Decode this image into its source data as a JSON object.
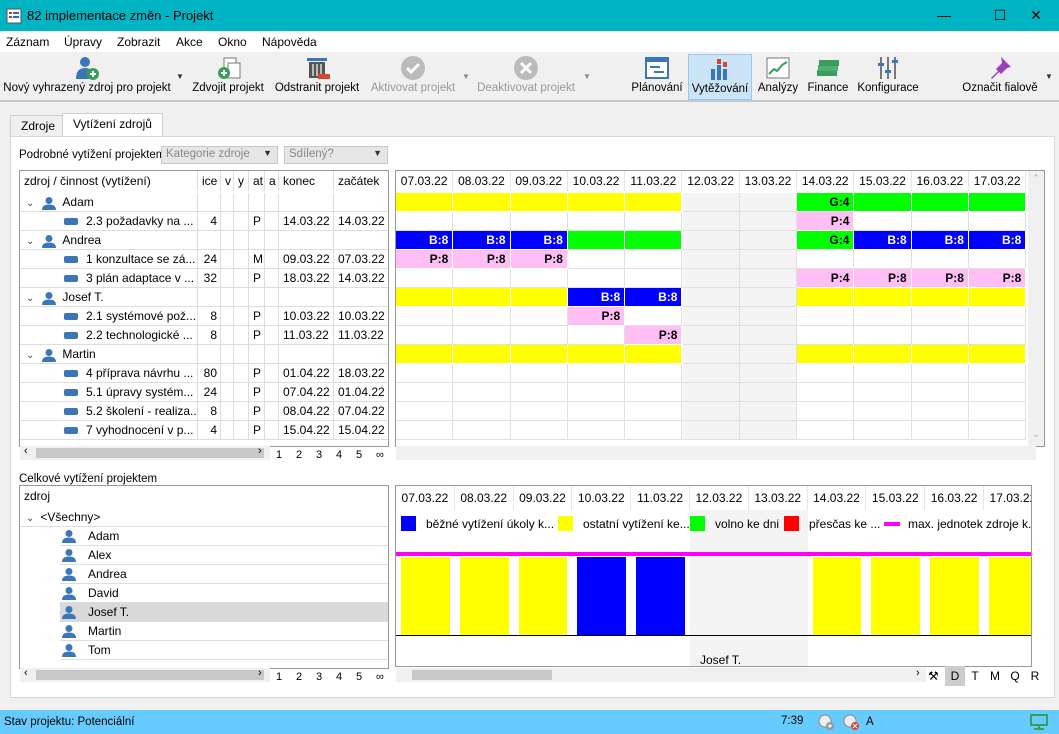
{
  "window": {
    "title": "82 implementace změn  - Projekt",
    "minimize": "—",
    "maximize": "☐",
    "close": "✕"
  },
  "menu": [
    "Záznam",
    "Úpravy",
    "Zobrazit",
    "Akce",
    "Okno",
    "Nápověda"
  ],
  "toolbar": [
    {
      "label": "Nový vyhrazený zdroj pro projekt",
      "icon": "add-user-icon",
      "enabled": true
    },
    {
      "label": "Zdvojit projekt",
      "icon": "duplicate-icon",
      "enabled": true
    },
    {
      "label": "Odstranit projekt",
      "icon": "trash-icon",
      "enabled": true
    },
    {
      "label": "Aktivovat projekt",
      "icon": "check-circle-icon",
      "enabled": false
    },
    {
      "label": "Deaktivovat projekt",
      "icon": "x-circle-icon",
      "enabled": false
    },
    {
      "label": "Plánování",
      "icon": "planning-icon",
      "enabled": true
    },
    {
      "label": "Vytěžování",
      "icon": "bar-chart-icon",
      "enabled": true,
      "active": true
    },
    {
      "label": "Analýzy",
      "icon": "line-chart-icon",
      "enabled": true
    },
    {
      "label": "Finance",
      "icon": "money-icon",
      "enabled": true
    },
    {
      "label": "Konfigurace",
      "icon": "sliders-icon",
      "enabled": true
    },
    {
      "label": "Označit fialově",
      "icon": "pin-icon",
      "enabled": true
    }
  ],
  "tabs": [
    {
      "label": "Zdroje"
    },
    {
      "label": "Vytížení zdrojů",
      "selected": true
    }
  ],
  "detail": {
    "label": "Podrobné vytížení projektem",
    "category_placeholder": "Kategorie zdroje",
    "shared_placeholder": "Sdílený?",
    "columns": [
      "zdroj / činnost (vytížení)",
      "ice",
      "v",
      "y",
      "at",
      "a",
      "konec",
      "začátek"
    ],
    "rows": [
      {
        "type": "resource",
        "name": "Adam"
      },
      {
        "type": "task",
        "name": "2.3 požadavky na ...",
        "hours": "4",
        "status": "P",
        "end": "14.03.22",
        "start": "14.03.22"
      },
      {
        "type": "resource",
        "name": "Andrea"
      },
      {
        "type": "task",
        "name": "1 konzultace se zá...",
        "hours": "24",
        "status": "M",
        "end": "09.03.22",
        "start": "07.03.22"
      },
      {
        "type": "task",
        "name": "3 plán adaptace v ...",
        "hours": "32",
        "status": "P",
        "end": "18.03.22",
        "start": "14.03.22"
      },
      {
        "type": "resource",
        "name": "Josef T."
      },
      {
        "type": "task",
        "name": "2.1 systémové pož...",
        "hours": "8",
        "status": "P",
        "end": "10.03.22",
        "start": "10.03.22"
      },
      {
        "type": "task",
        "name": "2.2 technologické ...",
        "hours": "8",
        "status": "P",
        "end": "11.03.22",
        "start": "11.03.22"
      },
      {
        "type": "resource",
        "name": "Martin"
      },
      {
        "type": "task",
        "name": "4 příprava návrhu ...",
        "hours": "80",
        "status": "P",
        "end": "01.04.22",
        "start": "18.03.22"
      },
      {
        "type": "task",
        "name": "5.1 úpravy systém...",
        "hours": "24",
        "status": "P",
        "end": "07.04.22",
        "start": "01.04.22"
      },
      {
        "type": "task",
        "name": "5.2 školení - realiza...",
        "hours": "8",
        "status": "P",
        "end": "08.04.22",
        "start": "07.04.22"
      },
      {
        "type": "task",
        "name": "7 vyhodnocení v p...",
        "hours": "4",
        "status": "P",
        "end": "15.04.22",
        "start": "15.04.22"
      }
    ],
    "pages": [
      "1",
      "2",
      "3",
      "4",
      "5",
      "∞"
    ]
  },
  "dates": [
    "07.03.22",
    "08.03.22",
    "09.03.22",
    "10.03.22",
    "11.03.22",
    "12.03.22",
    "13.03.22",
    "14.03.22",
    "15.03.22",
    "16.03.22",
    "17.03.22"
  ],
  "weekend_columns": [
    5,
    6
  ],
  "colors": {
    "Y": "#ffff00",
    "G": "#00ff00",
    "B": "#0000ff",
    "P": "#ffbff5",
    "R": "#ff0000",
    "M": "#ff00ff",
    "weekend": "#f4f4f4"
  },
  "grid": [
    [
      "Y",
      "Y",
      "Y",
      "Y",
      "Y",
      "",
      "",
      "G:4",
      "G",
      "G",
      "G"
    ],
    [
      "",
      "",
      "",
      "",
      "",
      "",
      "",
      "P:4",
      "",
      "",
      ""
    ],
    [
      "B:8",
      "B:8",
      "B:8",
      "G",
      "G",
      "",
      "",
      "G:4",
      "B:8",
      "B:8",
      "B:8"
    ],
    [
      "P:8",
      "P:8",
      "P:8",
      "",
      "",
      "",
      "",
      "",
      "",
      "",
      ""
    ],
    [
      "",
      "",
      "",
      "",
      "",
      "",
      "",
      "P:4",
      "P:8",
      "P:8",
      "P:8"
    ],
    [
      "Y",
      "Y",
      "Y",
      "B:8",
      "B:8",
      "",
      "",
      "Y",
      "Y",
      "Y",
      "Y"
    ],
    [
      "",
      "",
      "",
      "P:8",
      "",
      "",
      "",
      "",
      "",
      "",
      ""
    ],
    [
      "",
      "",
      "",
      "",
      "P:8",
      "",
      "",
      "",
      "",
      "",
      ""
    ],
    [
      "Y",
      "Y",
      "Y",
      "Y",
      "Y",
      "",
      "",
      "Y",
      "Y",
      "Y",
      "Y"
    ],
    [
      "",
      "",
      "",
      "",
      "",
      "",
      "",
      "",
      "",
      "",
      ""
    ],
    [
      "",
      "",
      "",
      "",
      "",
      "",
      "",
      "",
      "",
      "",
      ""
    ],
    [
      "",
      "",
      "",
      "",
      "",
      "",
      "",
      "",
      "",
      "",
      ""
    ],
    [
      "",
      "",
      "",
      "",
      "",
      "",
      "",
      "",
      "",
      "",
      ""
    ]
  ],
  "overall": {
    "label": "Celkové vytížení projektem",
    "column": "zdroj",
    "items": [
      "<Všechny>",
      "Adam",
      "Alex",
      "Andrea",
      "David",
      "Josef T.",
      "Martin",
      "Tom"
    ],
    "selected": "Josef T.",
    "pages": [
      "1",
      "2",
      "3",
      "4",
      "5",
      "∞"
    ],
    "legend": [
      {
        "color": "#0000ff",
        "label": "běžné vytížení úkoly k..."
      },
      {
        "color": "#ffff00",
        "label": "ostatní vytížení ke..."
      },
      {
        "color": "#00ff00",
        "label": "volno ke dni"
      },
      {
        "color": "#ff0000",
        "label": "přesčas ke ..."
      },
      {
        "color": "#ff00ff",
        "label": "max. jednotek zdroje k...",
        "line": true
      }
    ],
    "bars": [
      "Y",
      "Y",
      "Y",
      "B",
      "B",
      "",
      "",
      "Y",
      "Y",
      "Y",
      "Y"
    ],
    "resource_label": "Josef T.",
    "scales": [
      "D",
      "T",
      "M",
      "Q",
      "R"
    ],
    "active_scale": "D"
  },
  "status": {
    "text": "Stav projektu: Potenciální",
    "time": "7:39",
    "letter": "A"
  }
}
